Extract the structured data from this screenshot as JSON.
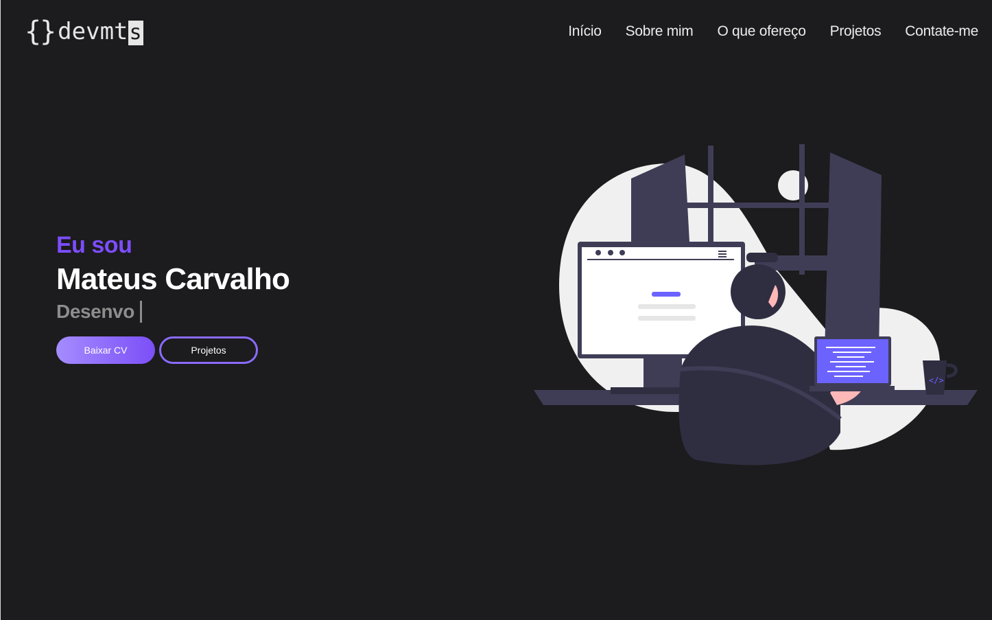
{
  "header": {
    "logo": {
      "braces": "{}",
      "text": "devmt",
      "cursor_letter": "s"
    },
    "nav": [
      "Início",
      "Sobre mim",
      "O que ofereço",
      "Projetos",
      "Contate-me"
    ]
  },
  "hero": {
    "eyebrow": "Eu sou",
    "name": "Mateus Carvalho",
    "typed_role": "Desenvo",
    "buttons": {
      "primary": "Baixar CV",
      "secondary": "Projetos"
    }
  },
  "colors": {
    "background": "#1c1b1d",
    "accent": "#7c4dff",
    "illustration_dark": "#3f3d56",
    "illustration_light": "#f0f0f0"
  }
}
